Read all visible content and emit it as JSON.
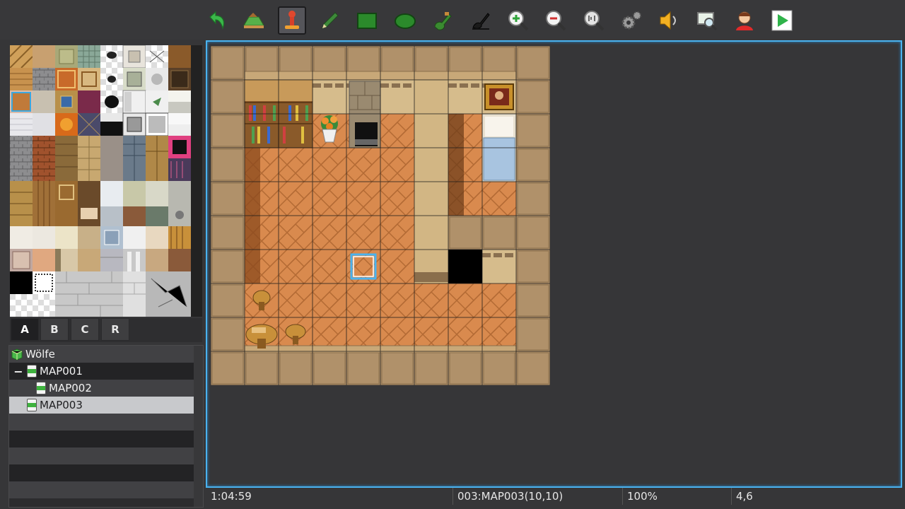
{
  "toolbar": {
    "tools": [
      {
        "id": "undo",
        "icon": "undo-arrow-icon"
      },
      {
        "id": "map-mode",
        "icon": "map-layer-icon"
      },
      {
        "id": "event-mode",
        "icon": "event-piece-icon",
        "active": true
      },
      {
        "id": "pencil",
        "icon": "pencil-icon"
      },
      {
        "id": "rectangle",
        "icon": "rectangle-icon"
      },
      {
        "id": "ellipse",
        "icon": "ellipse-icon"
      },
      {
        "id": "fill",
        "icon": "fill-bucket-icon"
      },
      {
        "id": "shadow-pen",
        "icon": "shadow-pen-icon"
      },
      {
        "id": "zoom-in",
        "icon": "zoom-in-icon"
      },
      {
        "id": "zoom-out",
        "icon": "zoom-out-icon"
      },
      {
        "id": "actual-size",
        "icon": "zoom-actual-icon"
      },
      {
        "id": "database",
        "icon": "gear-icon"
      },
      {
        "id": "sound-test",
        "icon": "speaker-icon"
      },
      {
        "id": "event-search",
        "icon": "search-screen-icon"
      },
      {
        "id": "character-generator",
        "icon": "character-icon"
      },
      {
        "id": "playtest",
        "icon": "play-icon"
      }
    ]
  },
  "tabs": [
    {
      "label": "A",
      "active": true
    },
    {
      "label": "B",
      "active": false
    },
    {
      "label": "C",
      "active": false
    },
    {
      "label": "R",
      "active": false
    }
  ],
  "tree": {
    "project": "Wölfe",
    "collapse_symbol": "−",
    "maps": [
      {
        "label": "MAP001",
        "selected": false
      },
      {
        "label": "MAP002",
        "selected": false
      },
      {
        "label": "MAP003",
        "selected": true
      }
    ]
  },
  "status": {
    "time": "1:04:59",
    "map": "003:MAP003(10,10)",
    "zoom": "100%",
    "coords": "4,6"
  },
  "colors": {
    "accent": "#4ab2ee",
    "floor": "#d88a4e",
    "wall": "#b0916a",
    "play": "#2fb34a"
  }
}
